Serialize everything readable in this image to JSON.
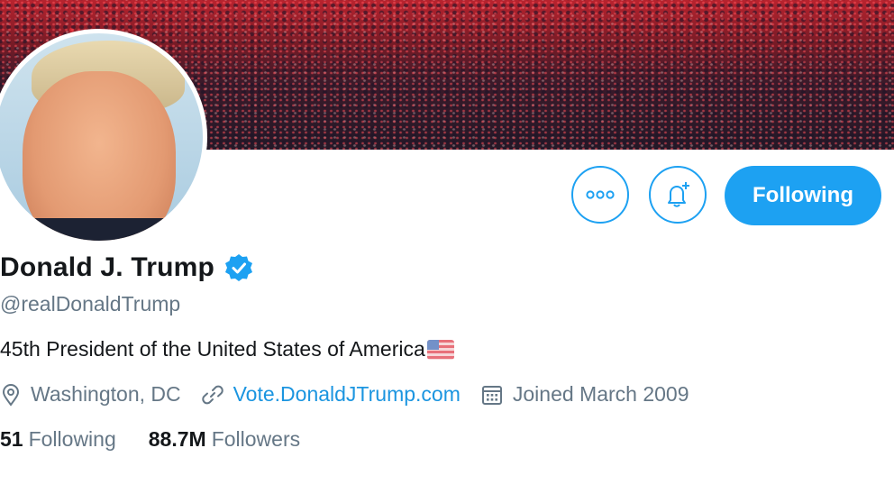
{
  "profile": {
    "name": "Donald J. Trump",
    "handle": "@realDonaldTrump",
    "bio": "45th President of the United States of America",
    "location": "Washington, DC",
    "website": "Vote.DonaldJTrump.com",
    "joined": "Joined March 2009",
    "following_count": "51",
    "following_label": "Following",
    "followers_count": "88.7M",
    "followers_label": "Followers",
    "verified": true
  },
  "actions": {
    "more_icon": "more-horizontal-icon",
    "notify_icon": "bell-plus-icon",
    "follow_label": "Following"
  },
  "colors": {
    "accent": "#1da1f2",
    "link": "#1b95e0",
    "muted": "#657786",
    "text": "#14171a"
  }
}
